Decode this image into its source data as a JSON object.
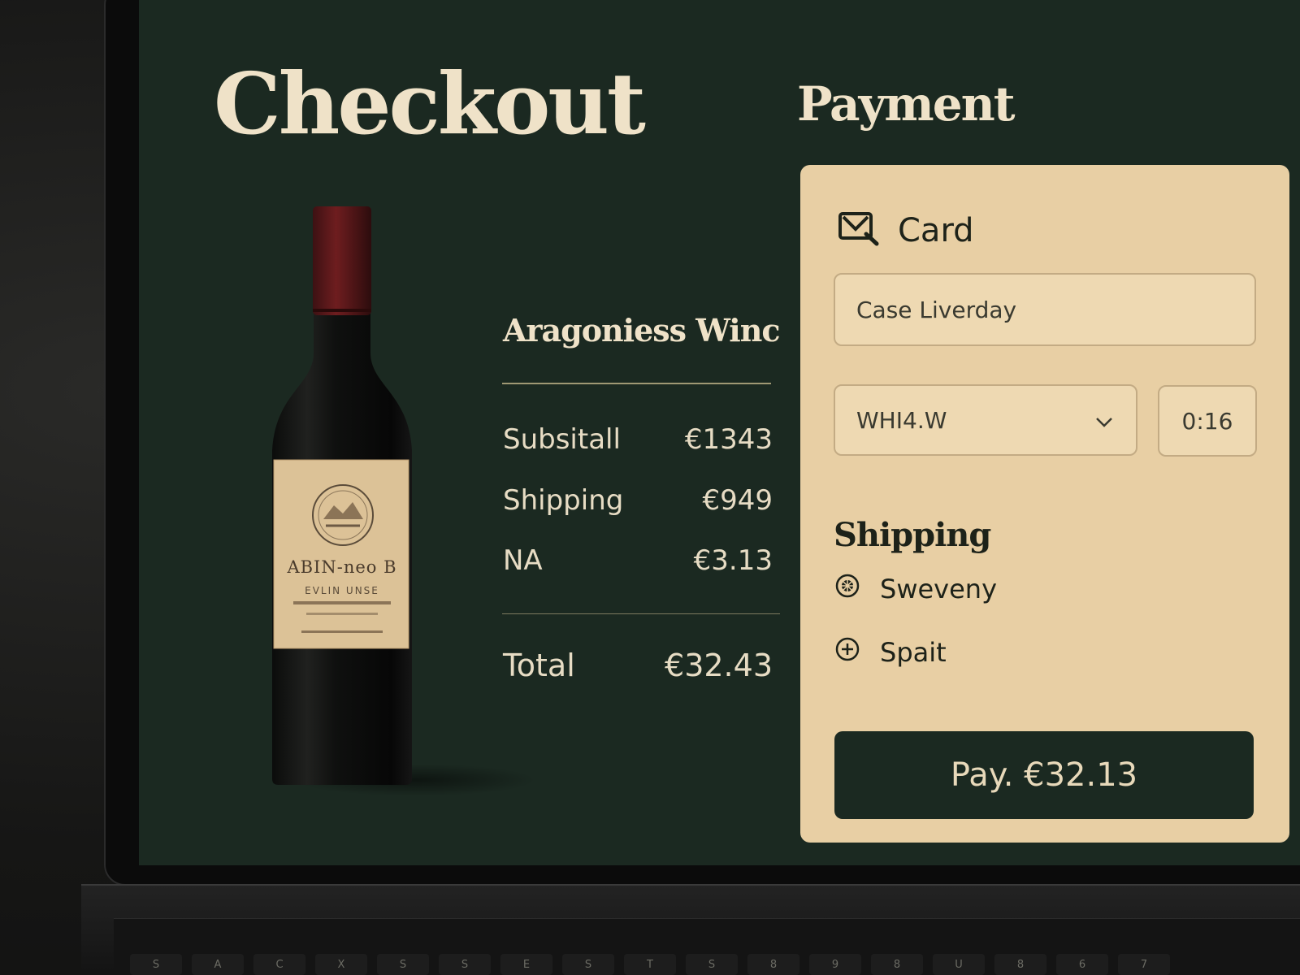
{
  "checkout": {
    "title": "Checkout"
  },
  "payment": {
    "title": "Payment",
    "method_label": "Card",
    "name_value": "Case Liverday",
    "select_value": "WHI4.W",
    "small_value": "0:16",
    "shipping_title": "Shipping",
    "shipping_options": [
      "Sweveny",
      "Spait"
    ],
    "pay_button": "Pay. €32.13"
  },
  "order": {
    "product_name": "Aragoniess Winc",
    "lines": [
      {
        "label": "Subsitall",
        "value": "€1343"
      },
      {
        "label": "Shipping",
        "value": "€949"
      },
      {
        "label": "NA",
        "value": "€3.13"
      }
    ],
    "total_label": "Total",
    "total_value": "€32.43"
  },
  "bottle_label": {
    "line1": "ABIN-neo B",
    "line2": "EVLIN UNSE"
  },
  "keyboard_keys": [
    "S",
    "A",
    "C",
    "X",
    "S",
    "S",
    "E",
    "S",
    "T",
    "S",
    "8",
    "9",
    "8",
    "U",
    "8",
    "6",
    "7"
  ],
  "colors": {
    "screen_bg": "#1b2921",
    "card_bg": "#e8cfa4",
    "heading_cream": "#efe2c8",
    "button_dark": "#1b2921",
    "bottle_capsule": "#6e1d1f"
  }
}
